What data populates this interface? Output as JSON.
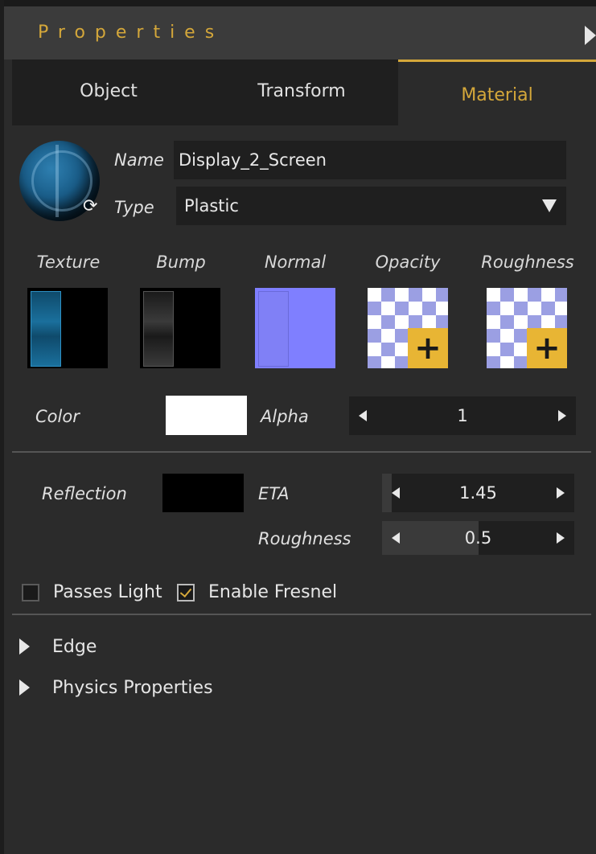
{
  "header": {
    "title": "Properties"
  },
  "tabs": [
    {
      "label": "Object"
    },
    {
      "label": "Transform"
    },
    {
      "label": "Material"
    }
  ],
  "material": {
    "name_label": "Name",
    "name_value": "Display_2_Screen",
    "type_label": "Type",
    "type_value": "Plastic"
  },
  "maps": [
    {
      "label": "Texture"
    },
    {
      "label": "Bump"
    },
    {
      "label": "Normal"
    },
    {
      "label": "Opacity"
    },
    {
      "label": "Roughness"
    }
  ],
  "color": {
    "label": "Color",
    "swatch": "#ffffff"
  },
  "alpha": {
    "label": "Alpha",
    "value": "1"
  },
  "reflection": {
    "label": "Reflection",
    "swatch": "#000000"
  },
  "eta": {
    "label": "ETA",
    "value": "1.45"
  },
  "roughness": {
    "label": "Roughness",
    "value": "0.5",
    "fill_fraction": 0.5
  },
  "options": {
    "passes_light": {
      "label": "Passes Light",
      "checked": false
    },
    "enable_fresnel": {
      "label": "Enable Fresnel",
      "checked": true
    }
  },
  "sections": [
    {
      "label": "Edge"
    },
    {
      "label": "Physics Properties"
    }
  ],
  "colors": {
    "accent": "#d4a73a",
    "panel": "#2b2b2b",
    "field": "#1f1f1f"
  }
}
